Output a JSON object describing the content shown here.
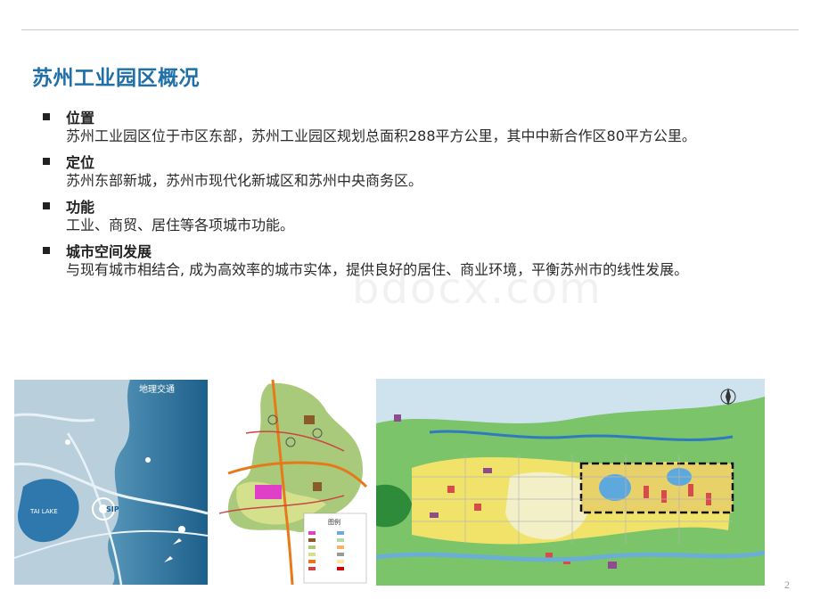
{
  "slide": {
    "title": "苏州工业园区概况",
    "page_number": "2",
    "watermark": "bdocx.com"
  },
  "sections": [
    {
      "heading": "位置",
      "text": "苏州工业园区位于市区东部，苏州工业园区规划总面积288平方公里，其中中新合作区80平方公里。"
    },
    {
      "heading": "定位",
      "text": "苏州东部新城，苏州市现代化新城区和苏州中央商务区。"
    },
    {
      "heading": "功能",
      "text": "工业、商贸、居住等各项城市功能。"
    },
    {
      "heading": "城市空间发展",
      "text": "与现有城市相结合, 成为高效率的城市实体，提供良好的居住、商业环境，平衡苏州市的线性发展。"
    }
  ],
  "images": {
    "map1": {
      "title": "地理交通",
      "lake_label": "TAI LAKE",
      "sip_label": "SIP"
    },
    "map2": {
      "legend_title": "图例"
    }
  }
}
